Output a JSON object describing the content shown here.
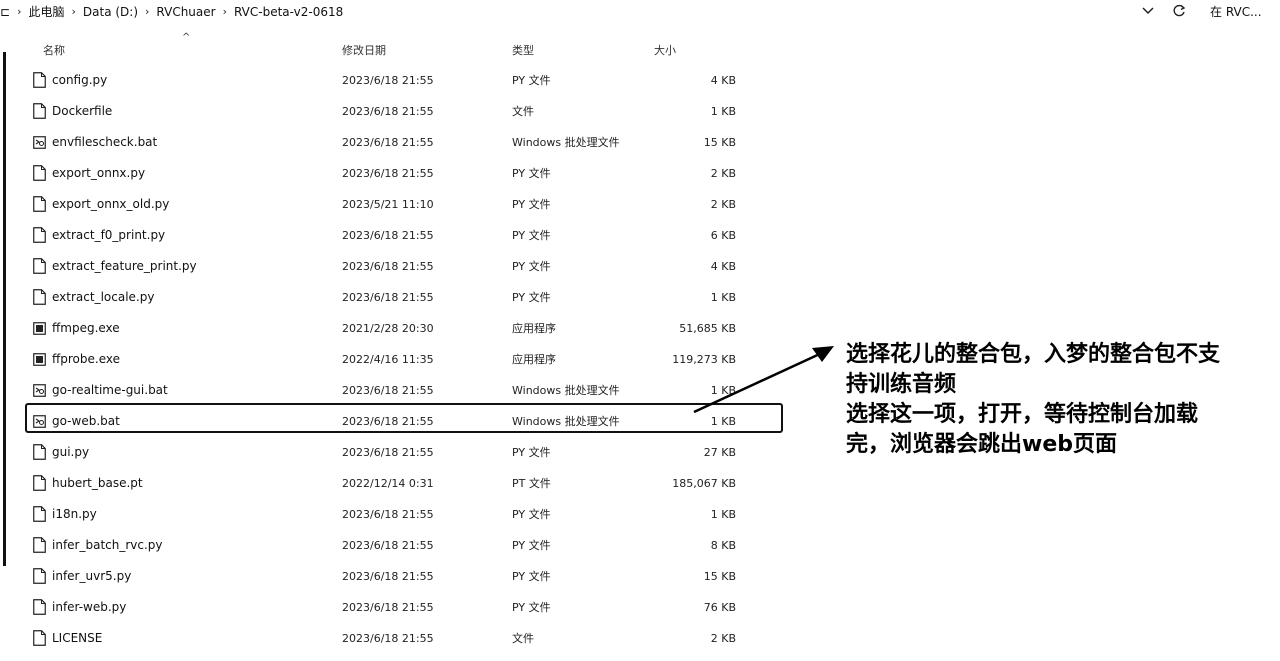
{
  "address": {
    "crumbs": [
      "此电脑",
      "Data (D:)",
      "RVChuaer",
      "RVC-beta-v2-0618"
    ],
    "search_partial": "在 RVC..."
  },
  "columns": {
    "name": "名称",
    "date": "修改日期",
    "type": "类型",
    "size": "大小"
  },
  "files": [
    {
      "name": "config.py",
      "date": "2023/6/18 21:55",
      "type": "PY 文件",
      "size": "4 KB",
      "icon": "file-icon"
    },
    {
      "name": "Dockerfile",
      "date": "2023/6/18 21:55",
      "type": "文件",
      "size": "1 KB",
      "icon": "file-icon"
    },
    {
      "name": "envfilescheck.bat",
      "date": "2023/6/18 21:55",
      "type": "Windows 批处理文件",
      "size": "15 KB",
      "icon": "batch-file-icon"
    },
    {
      "name": "export_onnx.py",
      "date": "2023/6/18 21:55",
      "type": "PY 文件",
      "size": "2 KB",
      "icon": "file-icon"
    },
    {
      "name": "export_onnx_old.py",
      "date": "2023/5/21 11:10",
      "type": "PY 文件",
      "size": "2 KB",
      "icon": "file-icon"
    },
    {
      "name": "extract_f0_print.py",
      "date": "2023/6/18 21:55",
      "type": "PY 文件",
      "size": "6 KB",
      "icon": "file-icon"
    },
    {
      "name": "extract_feature_print.py",
      "date": "2023/6/18 21:55",
      "type": "PY 文件",
      "size": "4 KB",
      "icon": "file-icon"
    },
    {
      "name": "extract_locale.py",
      "date": "2023/6/18 21:55",
      "type": "PY 文件",
      "size": "1 KB",
      "icon": "file-icon"
    },
    {
      "name": "ffmpeg.exe",
      "date": "2021/2/28 20:30",
      "type": "应用程序",
      "size": "51,685 KB",
      "icon": "exe-icon"
    },
    {
      "name": "ffprobe.exe",
      "date": "2022/4/16 11:35",
      "type": "应用程序",
      "size": "119,273 KB",
      "icon": "exe-icon"
    },
    {
      "name": "go-realtime-gui.bat",
      "date": "2023/6/18 21:55",
      "type": "Windows 批处理文件",
      "size": "1 KB",
      "icon": "batch-file-icon"
    },
    {
      "name": "go-web.bat",
      "date": "2023/6/18 21:55",
      "type": "Windows 批处理文件",
      "size": "1 KB",
      "icon": "batch-file-icon"
    },
    {
      "name": "gui.py",
      "date": "2023/6/18 21:55",
      "type": "PY 文件",
      "size": "27 KB",
      "icon": "file-icon"
    },
    {
      "name": "hubert_base.pt",
      "date": "2022/12/14 0:31",
      "type": "PT 文件",
      "size": "185,067 KB",
      "icon": "file-icon"
    },
    {
      "name": "i18n.py",
      "date": "2023/6/18 21:55",
      "type": "PY 文件",
      "size": "1 KB",
      "icon": "file-icon"
    },
    {
      "name": "infer_batch_rvc.py",
      "date": "2023/6/18 21:55",
      "type": "PY 文件",
      "size": "8 KB",
      "icon": "file-icon"
    },
    {
      "name": "infer_uvr5.py",
      "date": "2023/6/18 21:55",
      "type": "PY 文件",
      "size": "15 KB",
      "icon": "file-icon"
    },
    {
      "name": "infer-web.py",
      "date": "2023/6/18 21:55",
      "type": "PY 文件",
      "size": "76 KB",
      "icon": "file-icon"
    },
    {
      "name": "LICENSE",
      "date": "2023/6/18 21:55",
      "type": "文件",
      "size": "2 KB",
      "icon": "file-icon"
    }
  ],
  "annotation": {
    "lines": [
      "选择花儿的整合包，入梦的整合包不支",
      "持训练音频",
      "选择这一项，打开，等待控制台加载",
      "完，浏览器会跳出web页面"
    ]
  },
  "colors": {
    "text": "#111111",
    "border": "#111111",
    "background": "#ffffff"
  }
}
